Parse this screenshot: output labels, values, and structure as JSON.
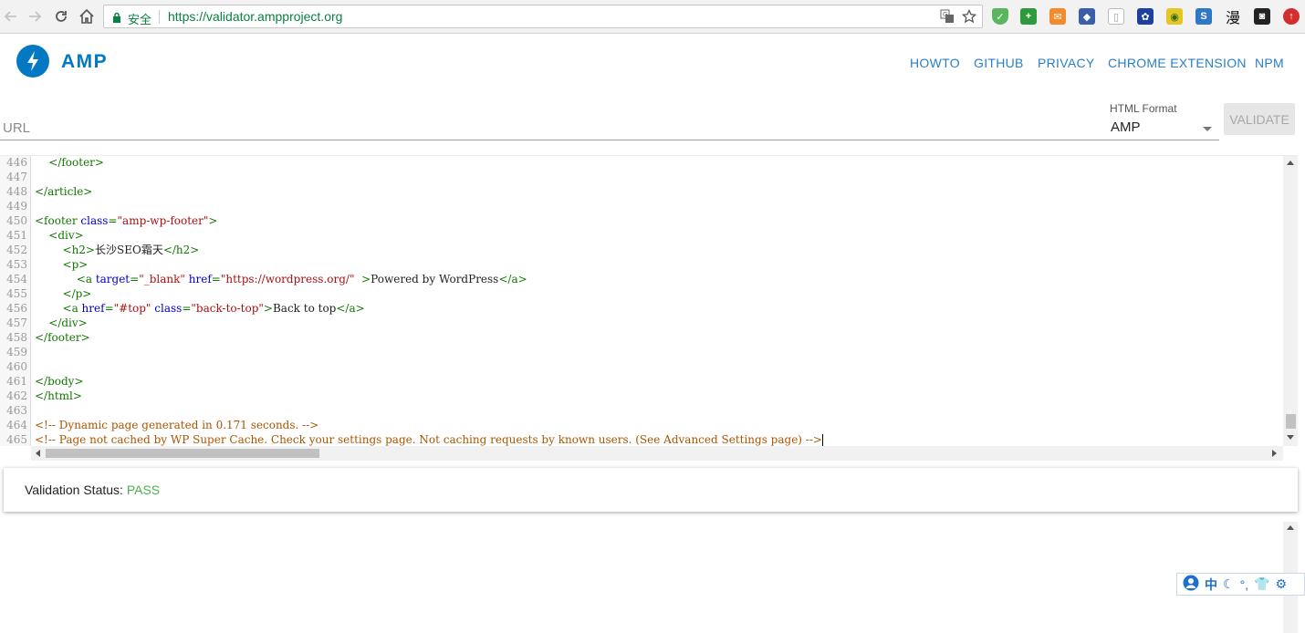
{
  "browser": {
    "secure_label": "安全",
    "url": "https://validator.ampproject.org",
    "extension_text_glyph": "漫"
  },
  "header": {
    "logo_text": "AMP",
    "nav": [
      "HOWTO",
      "GITHUB",
      "PRIVACY",
      "CHROME EXTENSION",
      "NPM"
    ]
  },
  "form": {
    "url_placeholder": "URL",
    "format_label": "HTML Format",
    "format_value": "AMP",
    "validate_label": "VALIDATE"
  },
  "editor": {
    "line_numbers": [
      "446",
      "447",
      "448",
      "449",
      "450",
      "451",
      "452",
      "453",
      "454",
      "455",
      "456",
      "457",
      "458",
      "459",
      "460",
      "461",
      "462",
      "463",
      "464",
      "465"
    ],
    "lines": [
      {
        "indent": "    ",
        "parts": [
          [
            "t",
            "</footer>"
          ]
        ]
      },
      {
        "indent": "",
        "parts": []
      },
      {
        "indent": "",
        "parts": [
          [
            "t",
            "</article>"
          ]
        ]
      },
      {
        "indent": "",
        "parts": []
      },
      {
        "indent": "",
        "parts": [
          [
            "t",
            "<footer "
          ],
          [
            "a",
            "class"
          ],
          [
            "t",
            "="
          ],
          [
            "s",
            "\"amp-wp-footer\""
          ],
          [
            "t",
            ">"
          ]
        ]
      },
      {
        "indent": "    ",
        "parts": [
          [
            "t",
            "<div>"
          ]
        ]
      },
      {
        "indent": "        ",
        "parts": [
          [
            "t",
            "<h2>"
          ],
          [
            "x",
            "长沙SEO霜天"
          ],
          [
            "t",
            "</h2>"
          ]
        ]
      },
      {
        "indent": "        ",
        "parts": [
          [
            "t",
            "<p>"
          ]
        ]
      },
      {
        "indent": "            ",
        "parts": [
          [
            "t",
            "<a "
          ],
          [
            "a",
            "target"
          ],
          [
            "t",
            "="
          ],
          [
            "s",
            "\"_blank\""
          ],
          [
            "t",
            " "
          ],
          [
            "a",
            "href"
          ],
          [
            "t",
            "="
          ],
          [
            "s",
            "\"https://wordpress.org/\""
          ],
          [
            "t",
            "  >"
          ],
          [
            "x",
            "Powered by WordPress"
          ],
          [
            "t",
            "</a>"
          ]
        ]
      },
      {
        "indent": "        ",
        "parts": [
          [
            "t",
            "</p>"
          ]
        ]
      },
      {
        "indent": "        ",
        "parts": [
          [
            "t",
            "<a "
          ],
          [
            "a",
            "href"
          ],
          [
            "t",
            "="
          ],
          [
            "s",
            "\"#top\""
          ],
          [
            "t",
            " "
          ],
          [
            "a",
            "class"
          ],
          [
            "t",
            "="
          ],
          [
            "s",
            "\"back-to-top\""
          ],
          [
            "t",
            ">"
          ],
          [
            "x",
            "Back to top"
          ],
          [
            "t",
            "</a>"
          ]
        ]
      },
      {
        "indent": "    ",
        "parts": [
          [
            "t",
            "</div>"
          ]
        ]
      },
      {
        "indent": "",
        "parts": [
          [
            "t",
            "</footer>"
          ]
        ]
      },
      {
        "indent": "",
        "parts": []
      },
      {
        "indent": "",
        "parts": []
      },
      {
        "indent": "",
        "parts": [
          [
            "t",
            "</body>"
          ]
        ]
      },
      {
        "indent": "",
        "parts": [
          [
            "t",
            "</html>"
          ]
        ]
      },
      {
        "indent": "",
        "parts": []
      },
      {
        "indent": "",
        "parts": [
          [
            "c",
            "<!-- Dynamic page generated in 0.171 seconds. -->"
          ]
        ]
      },
      {
        "indent": "",
        "parts": [
          [
            "c",
            "<!-- Page not cached by WP Super Cache. Check your settings page. Not caching requests by known users. (See Advanced Settings page) -->"
          ]
        ]
      }
    ]
  },
  "status": {
    "label": "Validation Status:",
    "value": "PASS"
  },
  "ime_bar": {
    "lang_char": "中"
  },
  "colors": {
    "amp_blue": "#0379c4",
    "nav_blue": "#2a7fc6",
    "pass_green": "#4caf50",
    "secure_green": "#0b8043"
  }
}
